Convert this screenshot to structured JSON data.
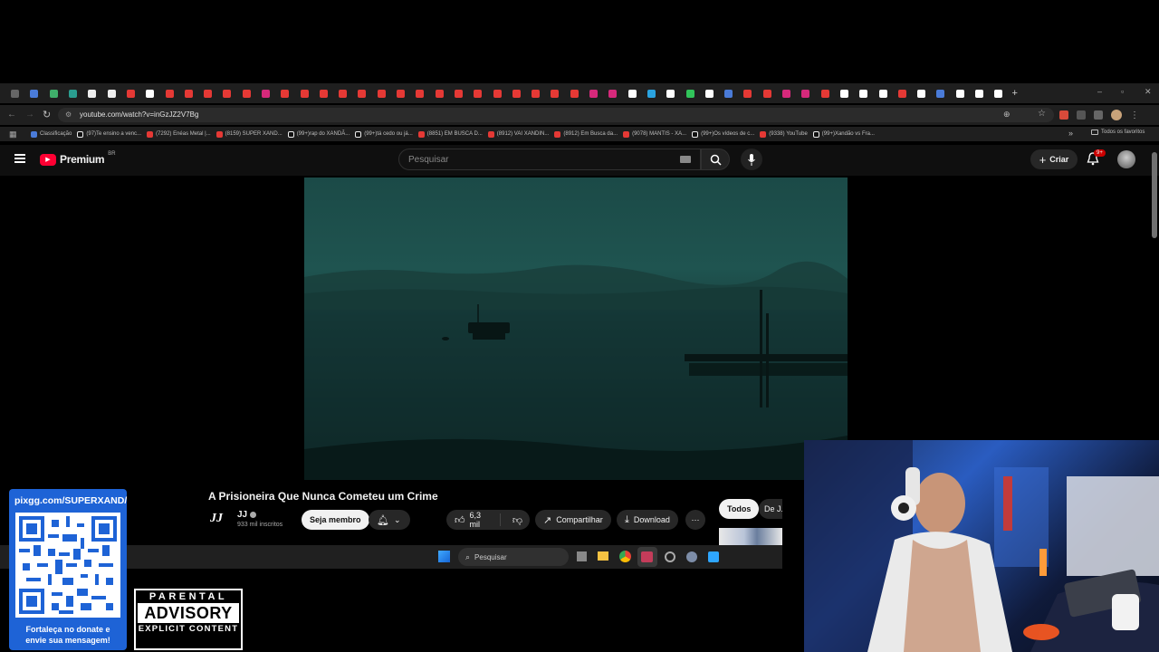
{
  "browser": {
    "url": "youtube.com/watch?v=inGzJZ2V7Bg",
    "all_bookmarks_label": "Todos os favoritos",
    "bookmarks": [
      {
        "label": "Classificação",
        "icon": "blue"
      },
      {
        "label": "(97)Te ensino a venc...",
        "icon": "tiktok"
      },
      {
        "label": "(7292) Enéas Metal |...",
        "icon": "youtube"
      },
      {
        "label": "(8159) SUPER XAND...",
        "icon": "youtube"
      },
      {
        "label": "(99+)rap do XANDÃ...",
        "icon": "tiktok"
      },
      {
        "label": "(99+)tá cedo ou já...",
        "icon": "tiktok"
      },
      {
        "label": "(8851) EM BUSCA D...",
        "icon": "youtube"
      },
      {
        "label": "(8912) VAI XANDIN...",
        "icon": "youtube"
      },
      {
        "label": "(8912) Em Busca da...",
        "icon": "youtube"
      },
      {
        "label": "(9078) MANTIS - XA...",
        "icon": "youtube"
      },
      {
        "label": "(99+)Os vídeos de c...",
        "icon": "tiktok"
      },
      {
        "label": "(9338) YouTube",
        "icon": "youtube"
      },
      {
        "label": "(99+)Xandão vs Fra...",
        "icon": "tiktok"
      }
    ]
  },
  "youtube": {
    "logo_label": "Premium",
    "logo_region": "BR",
    "search_placeholder": "Pesquisar",
    "create_label": "Criar",
    "notifications_badge": "9+",
    "video_title": "A Prisioneira Que Nunca Cometeu um Crime",
    "channel_name": "JJ",
    "channel_logo_text": "JJ",
    "subscribers": "933 mil inscritos",
    "member_label": "Seja membro",
    "likes": "6,3 mil",
    "share_label": "Compartilhar",
    "download_label": "Download",
    "chip_all": "Todos",
    "chip_channel": "De J..."
  },
  "taskbar": {
    "search_placeholder": "Pesquisar"
  },
  "overlay": {
    "pix_url": "pixgg.com/SUPERXAND/",
    "donate_line1": "Fortaleça no donate e",
    "donate_line2": "envie sua mensagem!",
    "advisory_top": "PARENTAL",
    "advisory_mid": "ADVISORY",
    "advisory_bottom": "EXPLICIT CONTENT"
  },
  "colors": {
    "youtube_red": "#ff0033",
    "browser_bg": "#1f1f1f",
    "page_bg": "#0f0f0f",
    "pix_blue": "#1e63d6"
  }
}
